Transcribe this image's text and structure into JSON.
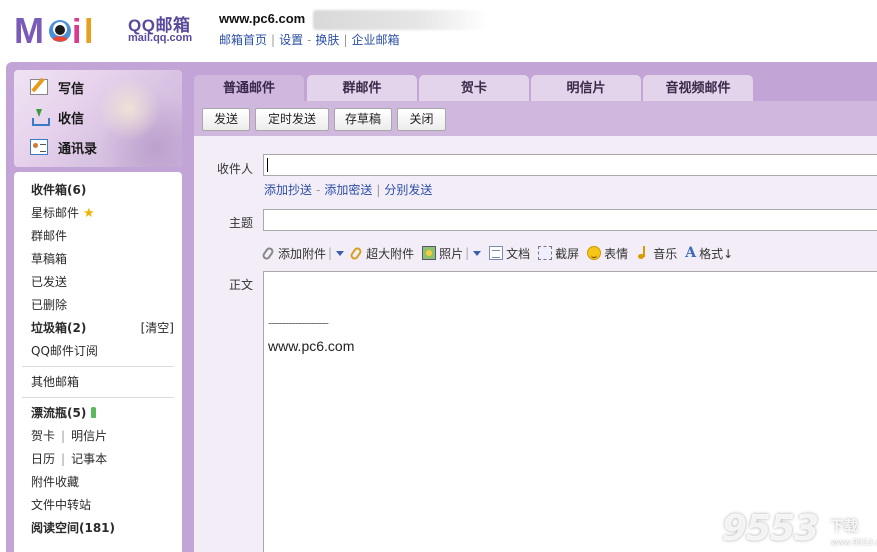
{
  "header": {
    "brand_name": "QQ邮箱",
    "brand_domain": "mail.qq.com",
    "account": "www.pc6.com",
    "links": [
      "邮箱首页",
      "设置",
      "换肤",
      "企业邮箱"
    ],
    "link_separators": [
      "|",
      "-",
      "|"
    ]
  },
  "quick_actions": {
    "compose": "写信",
    "inbox": "收信",
    "contacts": "通讯录"
  },
  "sidebar": {
    "inbox": "收件箱(6)",
    "starred": "星标邮件",
    "group": "群邮件",
    "drafts": "草稿箱",
    "sent": "已发送",
    "deleted": "已删除",
    "spam": "垃圾箱(2)",
    "spam_clear": "[清空]",
    "subscriptions": "QQ邮件订阅",
    "other_mailboxes": "其他邮箱",
    "drift_bottle": "漂流瓶(5)",
    "greeting_card": "贺卡",
    "postcard": "明信片",
    "calendar": "日历",
    "notebook": "记事本",
    "attachments": "附件收藏",
    "file_transfer": "文件中转站",
    "reading_space": "阅读空间(181)",
    "pipe": "|"
  },
  "tabs": [
    "普通邮件",
    "群邮件",
    "贺卡",
    "明信片",
    "音视频邮件"
  ],
  "toolbar": {
    "send": "发送",
    "scheduled_send": "定时发送",
    "save_draft": "存草稿",
    "close": "关闭"
  },
  "compose": {
    "to_label": "收件人",
    "to_value": "",
    "cc_links": [
      "添加抄送",
      "添加密送",
      "分别发送"
    ],
    "cc_separators": [
      "-",
      "|"
    ],
    "subject_label": "主题",
    "subject_value": "",
    "body_label": "正文",
    "attach_bar": {
      "add_attachment": "添加附件",
      "large_attachment": "超大附件",
      "photo": "照片",
      "document": "文档",
      "screenshot": "截屏",
      "emoji": "表情",
      "music": "音乐",
      "format": "格式↓",
      "vbar": "|"
    },
    "signature_line": "------------------",
    "signature_text": "www.pc6.com"
  },
  "watermark": {
    "number": "9553",
    "suffix": "下载",
    "domain": "www.9553.com"
  },
  "colors": {
    "frame_purple": "#c2a5d6",
    "tab_active": "#cfb7dd",
    "tab_inactive": "#e3d4ec",
    "link_blue": "#2a4ea6",
    "brand_purple": "#5b4a9b"
  }
}
